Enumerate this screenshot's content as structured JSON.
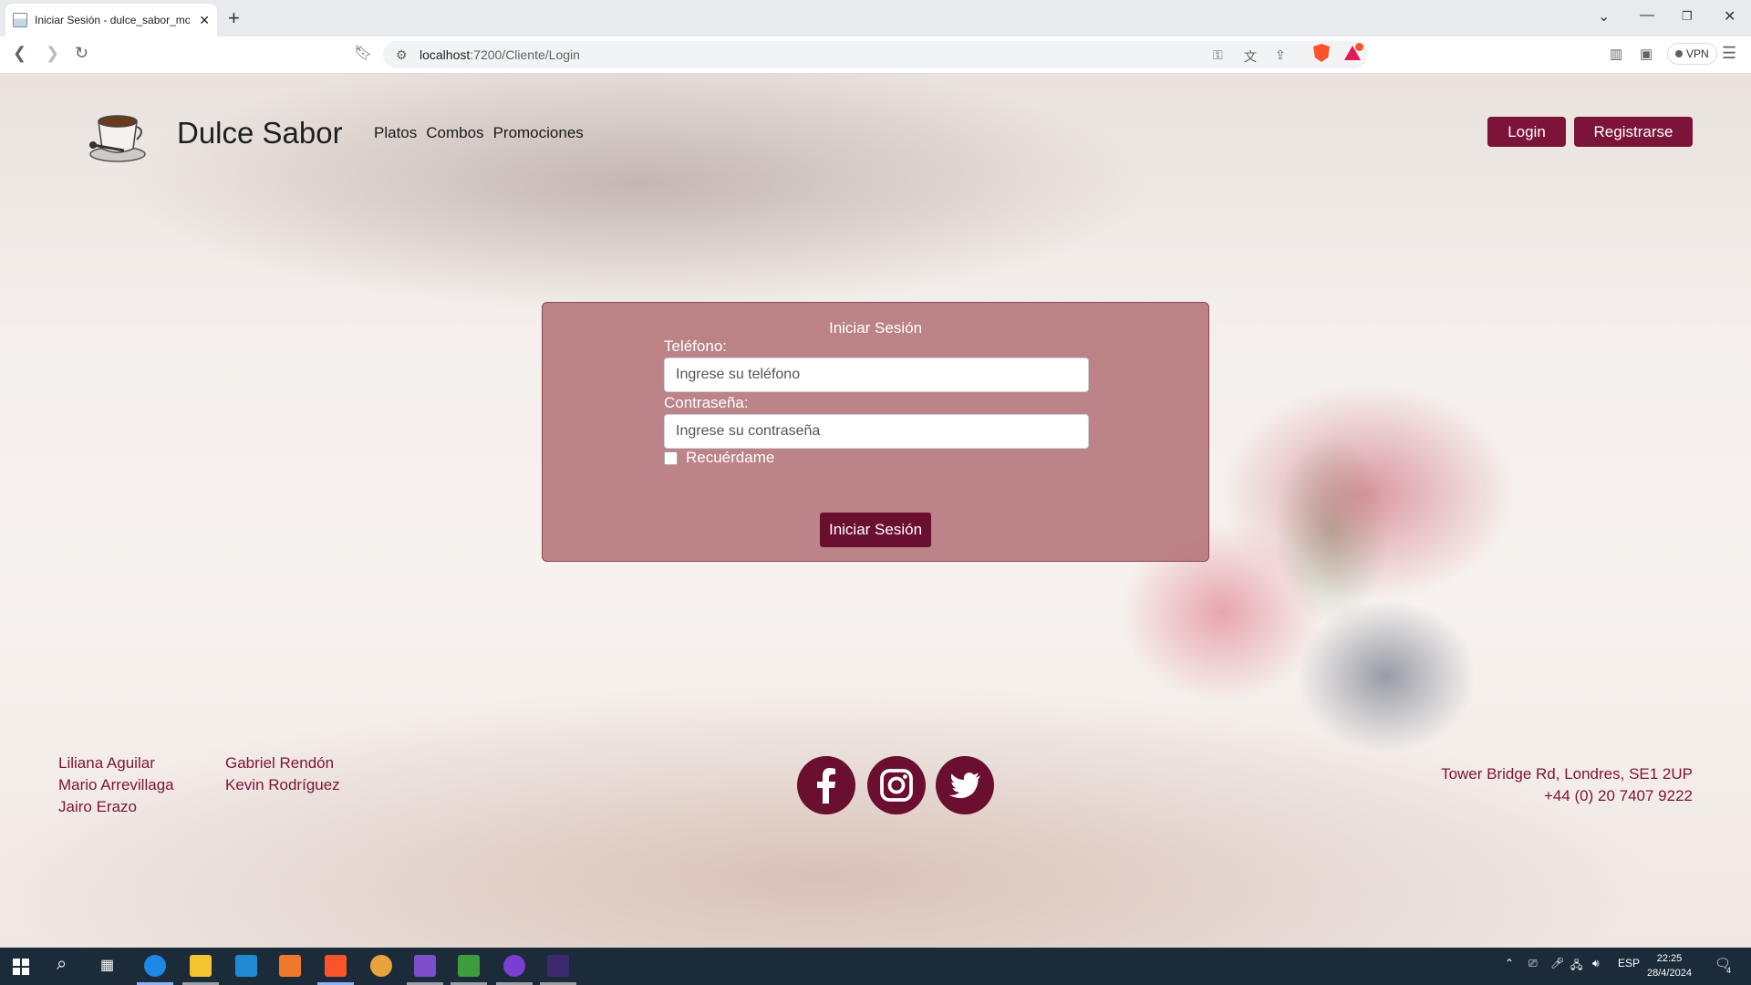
{
  "browser": {
    "tab_title": "Iniciar Sesión - dulce_sabor_mo",
    "url_host": "localhost",
    "url_path": ":7200/Cliente/Login",
    "vpn_label": "VPN"
  },
  "header": {
    "brand": "Dulce Sabor",
    "nav": [
      "Platos",
      "Combos",
      "Promociones"
    ],
    "login_label": "Login",
    "register_label": "Registrarse"
  },
  "login_form": {
    "title": "Iniciar Sesión",
    "phone_label": "Teléfono:",
    "phone_placeholder": "Ingrese su teléfono",
    "password_label": "Contraseña:",
    "password_placeholder": "Ingrese su contraseña",
    "remember_label": "Recuérdame",
    "submit_label": "Iniciar Sesión"
  },
  "footer": {
    "team_col1": [
      "Liliana Aguilar",
      "Mario Arrevillaga",
      "Jairo Erazo"
    ],
    "team_col2": [
      "Gabriel Rendón",
      "Kevin Rodríguez"
    ],
    "social": [
      "facebook-icon",
      "instagram-icon",
      "twitter-icon"
    ],
    "address": "Tower Bridge Rd, Londres, SE1 2UP",
    "phone": "+44 (0) 20 7407 9222"
  },
  "taskbar": {
    "language": "ESP",
    "time": "22:25",
    "date": "28/4/2024",
    "notification_count": "4"
  },
  "colors": {
    "brand": "#7b1438",
    "card": "#b27076",
    "submit": "#6a0f30"
  }
}
